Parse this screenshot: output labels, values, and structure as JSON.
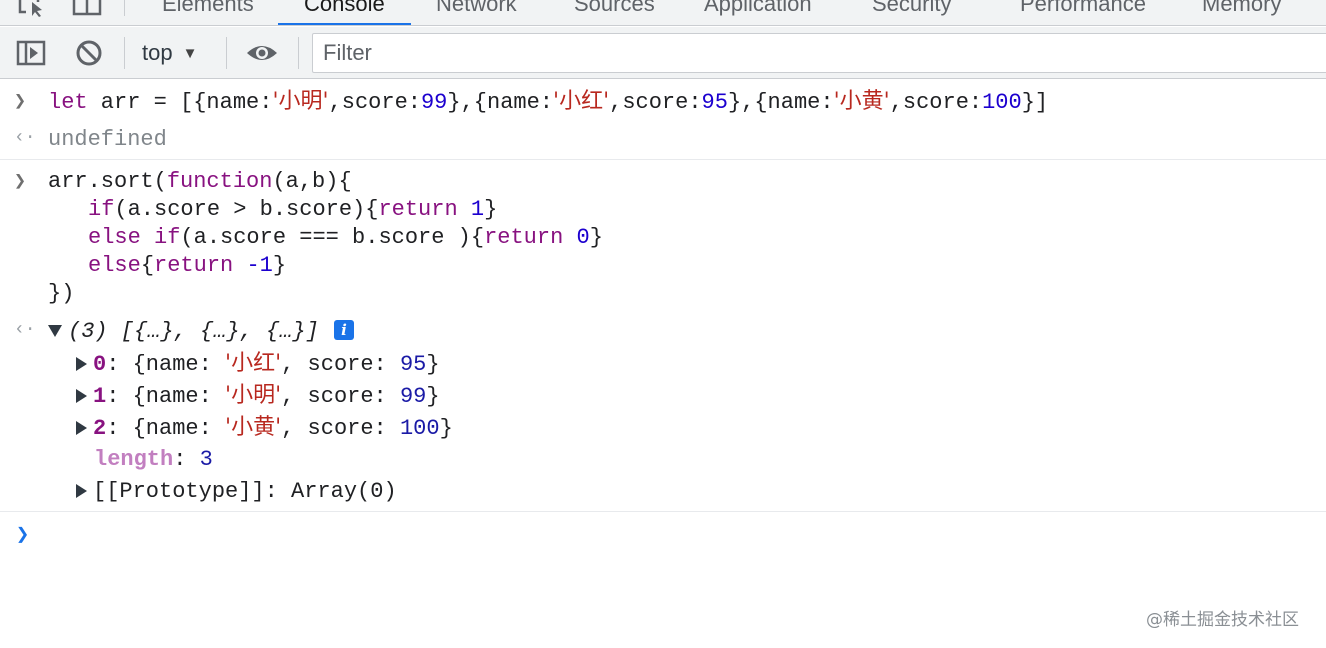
{
  "tabs": [
    {
      "label": "Elements",
      "active": false
    },
    {
      "label": "Console",
      "active": true
    },
    {
      "label": "Network",
      "active": false
    },
    {
      "label": "Sources",
      "active": false
    },
    {
      "label": "Application",
      "active": false
    },
    {
      "label": "Security",
      "active": false
    },
    {
      "label": "Performance",
      "active": false
    },
    {
      "label": "Memory",
      "active": false
    }
  ],
  "toolbar": {
    "context": "top",
    "filter_placeholder": "Filter"
  },
  "console": {
    "input1": {
      "kw_let": "let",
      "rest_a": " arr = [{name:",
      "s1": "'小明'",
      "rest_b": ",score:",
      "n1": "99",
      "rest_c": "},{name:",
      "s2": "'小红'",
      "rest_d": ",score:",
      "n2": "95",
      "rest_e": "},{name:",
      "s3": "'小黄'",
      "rest_f": ",score:",
      "n3": "100",
      "rest_g": "}]"
    },
    "result1": "undefined",
    "input2": {
      "l1_a": "arr.sort(",
      "l1_kw": "function",
      "l1_b": "(a,b){",
      "l2_kw1": "if",
      "l2_a": "(a.score > b.score){",
      "l2_kw2": "return",
      "l2_num": "1",
      "l2_b": "}",
      "l3_kw1": "else",
      "l3_kw2": "if",
      "l3_a": "(a.score === b.score ){",
      "l3_kw3": "return",
      "l3_num": "0",
      "l3_b": "}",
      "l4_kw1": "else",
      "l4_a": "{",
      "l4_kw2": "return",
      "l4_num": "-1",
      "l4_b": "}",
      "l5": "})"
    },
    "result2": {
      "summary": "(3) [{…}, {…}, {…}]",
      "info_icon": "i",
      "items": [
        {
          "index": "0",
          "name": "'小红'",
          "score": "95"
        },
        {
          "index": "1",
          "name": "'小明'",
          "score": "99"
        },
        {
          "index": "2",
          "name": "'小黄'",
          "score": "100"
        }
      ],
      "length_key": "length",
      "length_value": "3",
      "prototype": "[[Prototype]]: Array(0)"
    }
  },
  "watermark": "@稀土掘金技术社区"
}
